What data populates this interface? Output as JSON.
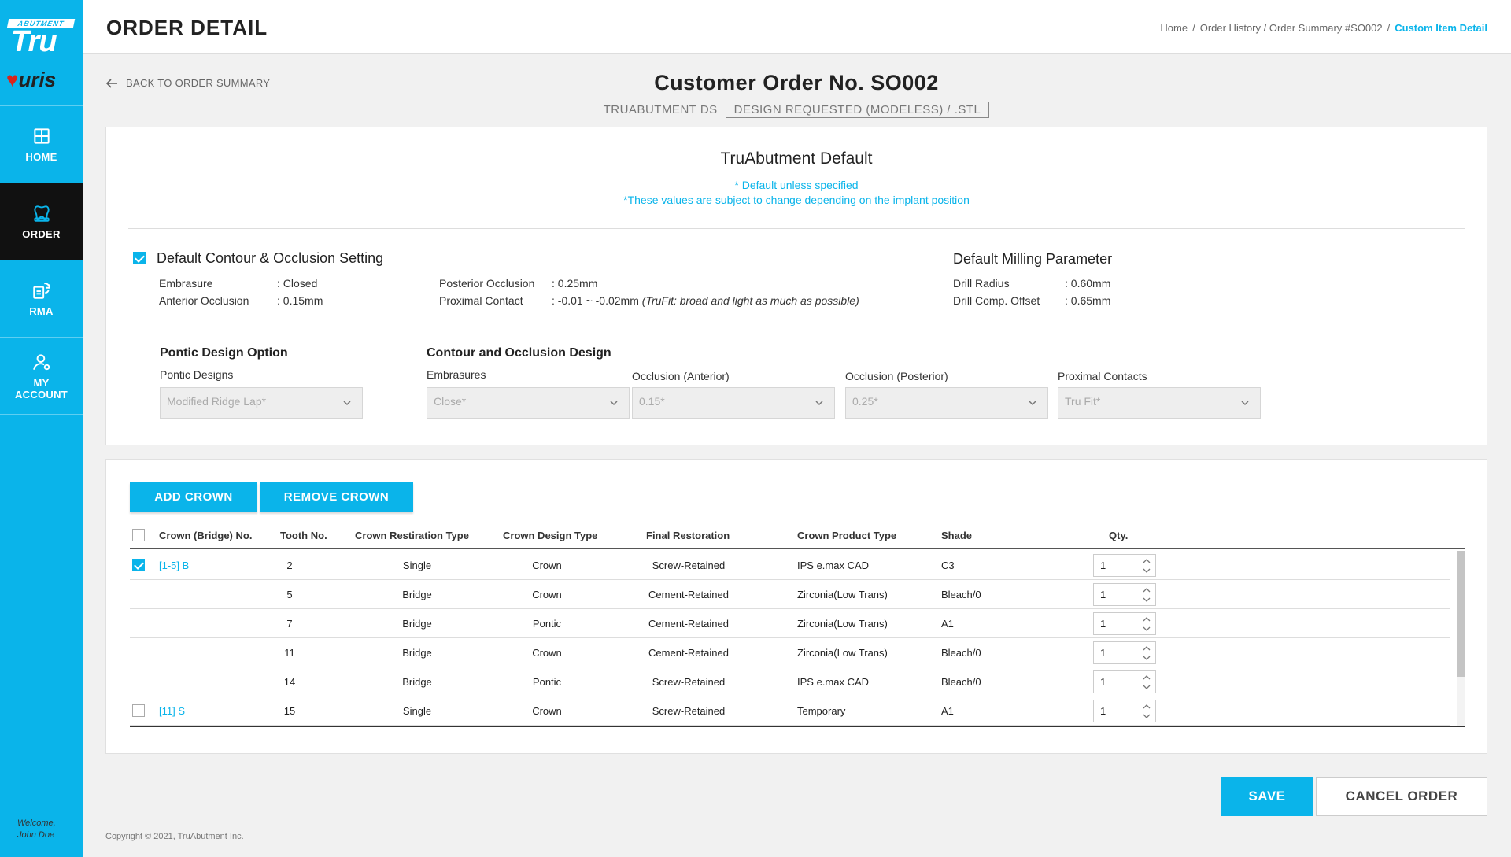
{
  "brand": {
    "logo_top": "ABUTMENT",
    "logo_main": "Tru",
    "logo_secondary": "uris"
  },
  "sidebar": {
    "items": [
      {
        "label": "HOME",
        "icon": "home-icon"
      },
      {
        "label": "ORDER",
        "icon": "tooth-icon"
      },
      {
        "label": "RMA",
        "icon": "rma-icon"
      },
      {
        "label": "MY ACCOUNT",
        "icon": "account-icon"
      }
    ],
    "welcome_line1": "Welcome,",
    "welcome_line2": "John Doe"
  },
  "header": {
    "title": "ORDER DETAIL",
    "breadcrumb": [
      "Home",
      "/",
      "Order History / Order Summary #SO002",
      "/",
      "Custom Item Detail"
    ]
  },
  "back_label": "BACK TO ORDER SUMMARY",
  "order": {
    "number_label": "Customer Order No. SO002",
    "product": "TRUABUTMENT DS",
    "tag": "DESIGN REQUESTED (MODELESS) / .STL"
  },
  "defaults": {
    "title": "TruAbutment Default",
    "note1": "* Default unless specified",
    "note2": "*These values are subject to change depending on the implant position",
    "contour_title": "Default Contour & Occlusion Setting",
    "contour_checked": true,
    "contour_left": [
      {
        "key": "Embrasure",
        "value": ": Closed"
      },
      {
        "key": "Anterior Occlusion",
        "value": ": 0.15mm"
      }
    ],
    "contour_right": [
      {
        "key": "Posterior Occlusion",
        "value": ": 0.25mm",
        "note": ""
      },
      {
        "key": "Proximal Contact",
        "value": ": -0.01 ~ -0.02mm",
        "note": "(TruFit: broad and light as much as possible)"
      }
    ],
    "milling_title": "Default Milling Parameter",
    "milling": [
      {
        "key": "Drill Radius",
        "value": ": 0.60mm"
      },
      {
        "key": "Drill Comp. Offset",
        "value": ": 0.65mm"
      }
    ],
    "pontic_option_title": "Pontic Design Option",
    "pontic_label": "Pontic Designs",
    "pontic_value": "Modified Ridge Lap*",
    "contour_design_title": "Contour and Occlusion Design",
    "embrasures_label": "Embrasures",
    "embrasures_value": "Close*",
    "occ_ant_label": "Occlusion (Anterior)",
    "occ_ant_value": "0.15*",
    "occ_post_label": "Occlusion (Posterior)",
    "occ_post_value": "0.25*",
    "proximal_label": "Proximal Contacts",
    "proximal_value": "Tru Fit*"
  },
  "crowns": {
    "add_label": "ADD CROWN",
    "remove_label": "REMOVE CROWN",
    "columns": [
      "Crown (Bridge) No.",
      "Tooth No.",
      "Crown Restiration Type",
      "Crown Design Type",
      "Final Restoration",
      "Crown Product Type",
      "Shade",
      "Qty."
    ],
    "rows": [
      {
        "group": "[1-5] B",
        "checked": true,
        "tooth": "2",
        "restoration_type": "Single",
        "design_type": "Crown",
        "final": "Screw-Retained",
        "product": "IPS e.max CAD",
        "shade": "C3",
        "qty": "1"
      },
      {
        "group": "",
        "checked": null,
        "tooth": "5",
        "restoration_type": "Bridge",
        "design_type": "Crown",
        "final": "Cement-Retained",
        "product": "Zirconia(Low Trans)",
        "shade": "Bleach/0",
        "qty": "1"
      },
      {
        "group": "",
        "checked": null,
        "tooth": "7",
        "restoration_type": "Bridge",
        "design_type": "Pontic",
        "final": "Cement-Retained",
        "product": "Zirconia(Low Trans)",
        "shade": "A1",
        "qty": "1"
      },
      {
        "group": "",
        "checked": null,
        "tooth": "11",
        "restoration_type": "Bridge",
        "design_type": "Crown",
        "final": "Cement-Retained",
        "product": "Zirconia(Low Trans)",
        "shade": "Bleach/0",
        "qty": "1"
      },
      {
        "group": "",
        "checked": null,
        "tooth": "14",
        "restoration_type": "Bridge",
        "design_type": "Pontic",
        "final": "Screw-Retained",
        "product": "IPS e.max CAD",
        "shade": "Bleach/0",
        "qty": "1"
      },
      {
        "group": "[11] S",
        "checked": false,
        "tooth": "15",
        "restoration_type": "Single",
        "design_type": "Crown",
        "final": "Screw-Retained",
        "product": "Temporary",
        "shade": "A1",
        "qty": "1"
      }
    ]
  },
  "footer": {
    "save_label": "SAVE",
    "cancel_label": "CANCEL ORDER",
    "copyright": "Copyright © 2021, TruAbutment Inc."
  },
  "colors": {
    "accent": "#0ab4ea",
    "active_nav": "#111111"
  }
}
